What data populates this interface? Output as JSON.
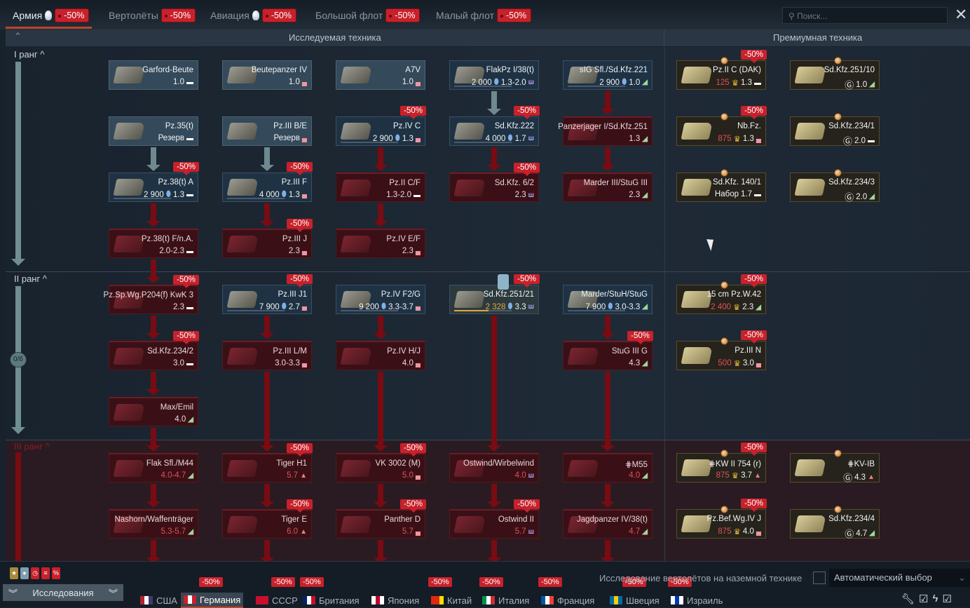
{
  "top_tabs": [
    {
      "label": "Армия",
      "discount": "-50%",
      "bulb": true,
      "active": true
    },
    {
      "label": "Вертолёты",
      "discount": "-50%"
    },
    {
      "label": "Авиация",
      "discount": "-50%",
      "bulb": true
    },
    {
      "label": "Большой флот",
      "discount": "-50%"
    },
    {
      "label": "Малый флот",
      "discount": "-50%"
    }
  ],
  "search": {
    "placeholder": "Поиск..."
  },
  "headers": {
    "researched": "Исследуемая техника",
    "premium": "Премиумная техника"
  },
  "ranks": [
    {
      "label": "I ранг ^"
    },
    {
      "label": "II ранг ^",
      "progress": "0/6"
    },
    {
      "label": "III ранг ^"
    }
  ],
  "vehicles": [
    {
      "name": "Garford-Beute",
      "br": "1.0",
      "role": "light",
      "state": "researched"
    },
    {
      "name": "Beutepanzer IV",
      "br": "1.0",
      "role": "medium",
      "state": "researched"
    },
    {
      "name": "A7V",
      "br": "1.0",
      "role": "medium",
      "state": "researched"
    },
    {
      "name": "FlakPz I/38(t)",
      "cost": "2 000",
      "br": "1.3-2.0",
      "role": "spaa",
      "state": "available"
    },
    {
      "name": "sIG Sfl./Sd.Kfz.221",
      "cost": "2 900",
      "br": "1.0",
      "role": "td",
      "state": "available"
    },
    {
      "name": "Pz.35(t)",
      "reserve": "Резерв",
      "role": "light",
      "state": "researched"
    },
    {
      "name": "Pz.III B/E",
      "reserve": "Резерв",
      "role": "medium",
      "state": "researched"
    },
    {
      "name": "Pz.IV C",
      "cost": "2 900",
      "br": "1.3",
      "role": "medium",
      "state": "available",
      "discount": "-50%"
    },
    {
      "name": "Sd.Kfz.222",
      "cost": "4 000",
      "br": "1.7",
      "role": "spaa",
      "state": "available",
      "discount": "-50%"
    },
    {
      "name": "Panzerjager I/Sd.Kfz.251",
      "br": "1.3",
      "role": "td",
      "state": "locked"
    },
    {
      "name": "Pz.38(t) A",
      "cost": "2 900",
      "br": "1.3",
      "role": "light",
      "state": "available",
      "discount": "-50%"
    },
    {
      "name": "Pz.III F",
      "cost": "4 000",
      "br": "1.3",
      "role": "medium",
      "state": "available",
      "discount": "-50%"
    },
    {
      "name": "Pz.II C/F",
      "br": "1.3-2.0",
      "role": "light",
      "state": "locked"
    },
    {
      "name": "Sd.Kfz. 6/2",
      "br": "2.3",
      "role": "spaa",
      "state": "locked",
      "discount": "-50%"
    },
    {
      "name": "Marder III/StuG III",
      "br": "2.3",
      "role": "td",
      "state": "locked"
    },
    {
      "name": "Pz.38(t) F/n.A.",
      "br": "2.0-2.3",
      "role": "light",
      "state": "locked"
    },
    {
      "name": "Pz.III J",
      "br": "2.3",
      "role": "medium",
      "state": "locked",
      "discount": "-50%"
    },
    {
      "name": "Pz.IV E/F",
      "br": "2.3",
      "role": "medium",
      "state": "locked"
    },
    {
      "name": "Pz.Sp.Wg.P204(f) KwK 3",
      "br": "2.3",
      "role": "light",
      "state": "locked",
      "discount": "-50%"
    },
    {
      "name": "Pz.III J1",
      "cost": "7 900",
      "br": "2.7",
      "role": "medium",
      "state": "available",
      "discount": "-50%"
    },
    {
      "name": "Pz.IV F2/G",
      "cost": "9 200",
      "br": "3.3-3.7",
      "role": "medium",
      "state": "available"
    },
    {
      "name": "Sd.Kfz.251/21",
      "cost": "2 328",
      "br": "3.3",
      "role": "spaa",
      "state": "researching",
      "discount": "-50%",
      "progress": 0.6
    },
    {
      "name": "Marder/StuH/StuG",
      "cost": "7 900",
      "br": "3.0-3.3",
      "role": "td",
      "state": "available"
    },
    {
      "name": "Sd.Kfz.234/2",
      "br": "3.0",
      "role": "light",
      "state": "locked",
      "discount": "-50%"
    },
    {
      "name": "Pz.III L/M",
      "br": "3.0-3.3",
      "role": "medium",
      "state": "locked"
    },
    {
      "name": "Pz.IV H/J",
      "br": "4.0",
      "role": "medium",
      "state": "locked"
    },
    {
      "name": "StuG III G",
      "br": "4.3",
      "role": "td",
      "state": "locked",
      "discount": "-50%"
    },
    {
      "name": "Max/Emil",
      "br": "4.0",
      "role": "td",
      "state": "locked"
    },
    {
      "name": "Flak Sfl./M44",
      "br": "4.0-4.7",
      "role": "td",
      "state": "locked",
      "redbr": true
    },
    {
      "name": "Tiger H1",
      "br": "5.7",
      "role": "heavy",
      "state": "locked",
      "discount": "-50%",
      "redbr": true
    },
    {
      "name": "VK 3002 (M)",
      "br": "5.0",
      "role": "medium",
      "state": "locked",
      "discount": "-50%",
      "redbr": true
    },
    {
      "name": "Ostwind/Wirbelwind",
      "br": "4.0",
      "role": "spaa",
      "state": "locked",
      "redbr": true
    },
    {
      "name": "⋕M55",
      "br": "4.0",
      "role": "td",
      "state": "locked",
      "redbr": true
    },
    {
      "name": "Nashorn/Waffenträger",
      "br": "5.3-5.7",
      "role": "td",
      "state": "locked",
      "redbr": true
    },
    {
      "name": "Tiger E",
      "br": "6.0",
      "role": "heavy",
      "state": "locked",
      "discount": "-50%",
      "redbr": true
    },
    {
      "name": "Panther D",
      "br": "5.7",
      "role": "medium",
      "state": "locked",
      "discount": "-50%",
      "redbr": true
    },
    {
      "name": "Ostwind II",
      "br": "5.7",
      "role": "spaa",
      "state": "locked",
      "discount": "-50%",
      "redbr": true
    },
    {
      "name": "Jagdpanzer IV/38(t)",
      "br": "4.7",
      "role": "td",
      "state": "locked",
      "redbr": true
    }
  ],
  "premium": [
    {
      "name": "Pz.II C (DAK)",
      "ge": "125",
      "br": "1.3",
      "role": "light",
      "discount": "-50%"
    },
    {
      "name": "Sd.Kfz.251/10",
      "gift": "Ⓖ",
      "br": "1.0",
      "role": "td"
    },
    {
      "name": "Nb.Fz.",
      "ge": "875",
      "br": "1.3",
      "role": "medium",
      "discount": "-50%"
    },
    {
      "name": "Sd.Kfz.234/1",
      "gift": "Ⓖ",
      "br": "2.0",
      "role": "light"
    },
    {
      "name": "Sd.Kfz. 140/1",
      "pack": "Набор",
      "br": "1.7",
      "role": "light"
    },
    {
      "name": "Sd.Kfz.234/3",
      "gift": "Ⓖ",
      "br": "2.0",
      "role": "td"
    },
    {
      "name": "15 cm Pz.W.42",
      "ge": "2 400",
      "br": "2.3",
      "role": "td",
      "discount": "-50%"
    },
    {
      "name": "Pz.III N",
      "ge": "500",
      "br": "3.0",
      "role": "medium",
      "discount": "-50%"
    },
    {
      "name": "⋕KW II 754 (r)",
      "ge": "875",
      "br": "3.7",
      "role": "heavy",
      "discount": "-50%"
    },
    {
      "name": "⋕KV-IB",
      "gift": "Ⓖ",
      "br": "4.3",
      "role": "heavy"
    },
    {
      "name": "Pz.Bef.Wg.IV J",
      "ge": "875",
      "br": "4.0",
      "role": "medium",
      "discount": "-50%"
    },
    {
      "name": "Sd.Kfz.234/4",
      "gift": "Ⓖ",
      "br": "4.7",
      "role": "td"
    }
  ],
  "role_glyphs": {
    "light": "▬",
    "medium": "▄",
    "heavy": "▲",
    "spaa": "ш",
    "td": "◢"
  },
  "bottom": {
    "research_button": "Исследования",
    "checkbox_label": "Исследование вертолётов на наземной технике",
    "dropdown_value": "Автоматический выбор",
    "countries": [
      {
        "label": "США",
        "colors": [
          "#b22234",
          "#fff",
          "#3c3b6e"
        ]
      },
      {
        "label": "Германия",
        "colors": [
          "#c8212b",
          "#fff",
          "#c8212b"
        ],
        "active": true,
        "discount": "-50%"
      },
      {
        "label": "СССР",
        "colors": [
          "#c8102e",
          "#c8102e",
          "#c8102e"
        ],
        "discount": "-50%"
      },
      {
        "label": "Британия",
        "colors": [
          "#012169",
          "#fff",
          "#c8102e"
        ],
        "discount": "-50%"
      },
      {
        "label": "Япония",
        "colors": [
          "#fff",
          "#bc002d",
          "#fff"
        ]
      },
      {
        "label": "Китай",
        "colors": [
          "#de2910",
          "#de2910",
          "#ffde00"
        ],
        "discount": "-50%"
      },
      {
        "label": "Италия",
        "colors": [
          "#009246",
          "#fff",
          "#ce2b37"
        ],
        "discount": "-50%"
      },
      {
        "label": "Франция",
        "colors": [
          "#0055a4",
          "#fff",
          "#ef4135"
        ],
        "discount": "-50%"
      },
      {
        "label": "Швеция",
        "colors": [
          "#006aa7",
          "#fecc00",
          "#006aa7"
        ],
        "discount": "-50%"
      },
      {
        "label": "Израиль",
        "colors": [
          "#fff",
          "#0038b8",
          "#fff"
        ],
        "discount": "-50%"
      }
    ]
  },
  "colors": {
    "accent": "#c0442c",
    "discount": "#c8212b",
    "locked": "#3a1016",
    "premium_border": "#5a4b2e"
  }
}
